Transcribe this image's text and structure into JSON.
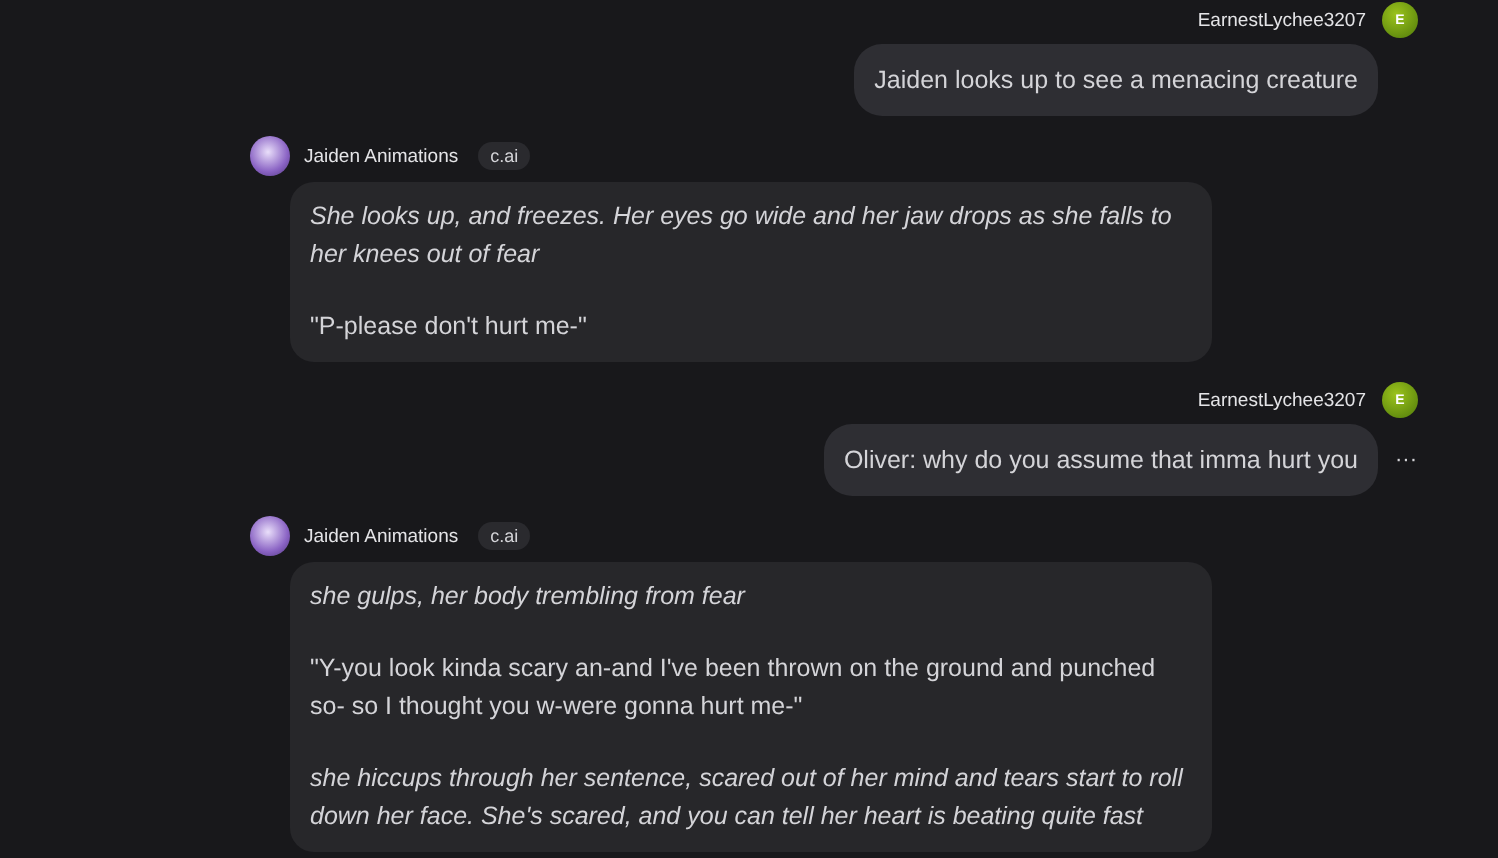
{
  "messages": [
    {
      "kind": "user",
      "author": "EarnestLychee3207",
      "avatar_letter": "E",
      "paragraphs": [
        {
          "kind": "speech",
          "text": "Jaiden looks up to see a menacing creature"
        }
      ]
    },
    {
      "kind": "bot",
      "author": "Jaiden Animations",
      "badge": "c.ai",
      "paragraphs": [
        {
          "kind": "action",
          "text": "She looks up, and freezes. Her eyes go wide and her jaw drops as she falls to her knees out of fear"
        },
        {
          "kind": "speech",
          "text": "\"P-please don't hurt me-\""
        }
      ]
    },
    {
      "kind": "user",
      "author": "EarnestLychee3207",
      "avatar_letter": "E",
      "more_icon": "···",
      "paragraphs": [
        {
          "kind": "speech",
          "text": "Oliver: why do you assume that imma hurt you"
        }
      ]
    },
    {
      "kind": "bot",
      "author": "Jaiden Animations",
      "badge": "c.ai",
      "paragraphs": [
        {
          "kind": "action",
          "text": "she gulps, her body trembling from fear"
        },
        {
          "kind": "speech",
          "text": "\"Y-you look kinda scary an-and I've been thrown on the ground and punched so- so I thought you w-were gonna hurt me-\""
        },
        {
          "kind": "action",
          "text": "she hiccups through her sentence, scared out of her mind and tears start to roll down her face. She's scared, and you can tell her heart is beating quite fast"
        }
      ]
    }
  ]
}
